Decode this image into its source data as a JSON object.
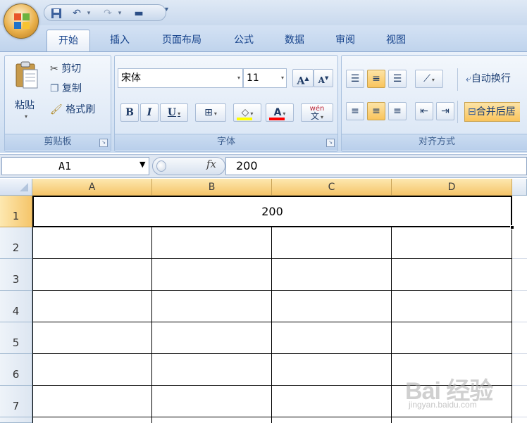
{
  "quick_access": {
    "save_icon": "save-icon",
    "undo_icon": "undo-icon",
    "redo_icon": "redo-icon",
    "customize_icon": "customize-icon"
  },
  "tabs": [
    {
      "label": "开始",
      "active": true
    },
    {
      "label": "插入"
    },
    {
      "label": "页面布局"
    },
    {
      "label": "公式"
    },
    {
      "label": "数据"
    },
    {
      "label": "审阅"
    },
    {
      "label": "视图"
    }
  ],
  "clipboard": {
    "paste_label": "粘贴",
    "cut_label": "剪切",
    "copy_label": "复制",
    "format_painter_label": "格式刷",
    "group_label": "剪贴板"
  },
  "font": {
    "font_name": "宋体",
    "font_size": "11",
    "grow_label": "A",
    "shrink_label": "A",
    "bold_label": "B",
    "italic_label": "I",
    "underline_label": "U",
    "phonetic_label": "wén",
    "group_label": "字体",
    "fill_color": "#ffff00",
    "font_color": "#ff0000"
  },
  "alignment": {
    "wrap_text_label": "自动换行",
    "merge_center_label": "合并后居",
    "group_label": "对齐方式"
  },
  "formula_bar": {
    "name_box": "A1",
    "fx_label": "fx",
    "formula_value": "200"
  },
  "sheet": {
    "columns": [
      "A",
      "B",
      "C",
      "D"
    ],
    "rows": [
      "1",
      "2",
      "3",
      "4",
      "5",
      "6",
      "7"
    ],
    "merged_cell_value": "200"
  },
  "watermark": {
    "text": "Bai 经验",
    "sub": "jingyan.baidu.com"
  },
  "colors": {
    "accent": "#f5c56a",
    "ribbon": "#d5e3f4",
    "tab_text": "#15428b"
  }
}
